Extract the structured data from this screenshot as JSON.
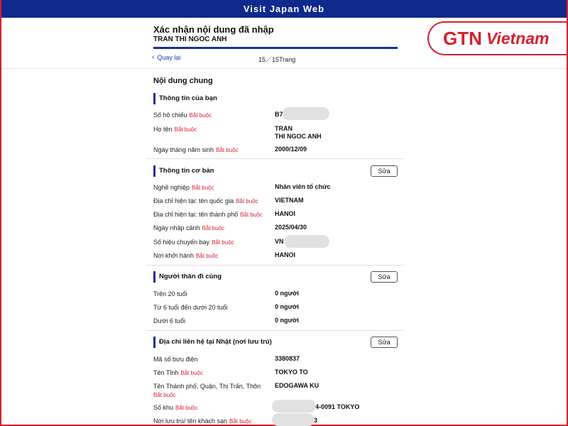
{
  "app": {
    "title": "Visit Japan Web"
  },
  "header": {
    "title": "Xác nhận nội dung đã nhập",
    "subtitle": "TRAN THI NGOC ANH",
    "back_label": "Quay lại",
    "page_count": "15／15Trang",
    "progress": 1.0
  },
  "logo": {
    "part1": "GTN",
    "part2": "Vietnam"
  },
  "general_title": "Nội dung chung",
  "required_label": "Bắt buộc",
  "edit_label": "Sửa",
  "sections": {
    "your_info": {
      "title": "Thông tin của bạn",
      "rows": [
        {
          "label": "Số hộ chiếu",
          "value": "B7"
        },
        {
          "label": "Họ tên",
          "value_line1": "TRAN",
          "value_line2": "THI NGOC ANH"
        },
        {
          "label": "Ngày tháng năm sinh",
          "value": "2000/12/09"
        }
      ]
    },
    "basic_info": {
      "title": "Thông tin cơ bản",
      "rows": [
        {
          "label": "Nghề nghiệp",
          "value": "Nhân viên tổ chức"
        },
        {
          "label": "Địa chỉ hiện tại: tên quốc gia",
          "value": "VIETNAM"
        },
        {
          "label": "Địa chỉ hiện tại: tên thành phố",
          "value": "HANOI"
        },
        {
          "label": "Ngày nhập cảnh",
          "value": "2025/04/30"
        },
        {
          "label": "Số hiệu chuyến bay",
          "value": "VN"
        },
        {
          "label": "Nơi khởi hành",
          "value": "HANOI"
        }
      ]
    },
    "companions": {
      "title": "Người thân đi cùng",
      "rows": [
        {
          "label": "Trên 20 tuổi",
          "value": "0 người"
        },
        {
          "label": "Từ 6 tuổi đến dưới 20 tuổi",
          "value": "0 người"
        },
        {
          "label": "Dưới 6 tuổi",
          "value": "0 người"
        }
      ]
    },
    "japan_address": {
      "title": "Địa chỉ liên hệ tại Nhật (nơi lưu trú)",
      "rows": [
        {
          "label": "Mã số bưu điện",
          "value": "3380837"
        },
        {
          "label": "Tên Tỉnh",
          "value": "TOKYO TO"
        },
        {
          "label": "Tên Thành phố, Quận, Thị Trấn, Thôn",
          "value": "EDOGAWA KU"
        },
        {
          "label": "Số khu",
          "value": "-4-0091 TOKYO"
        },
        {
          "label": "Nơi lưu trú/ tên khách sạn",
          "value": "3"
        }
      ]
    }
  }
}
